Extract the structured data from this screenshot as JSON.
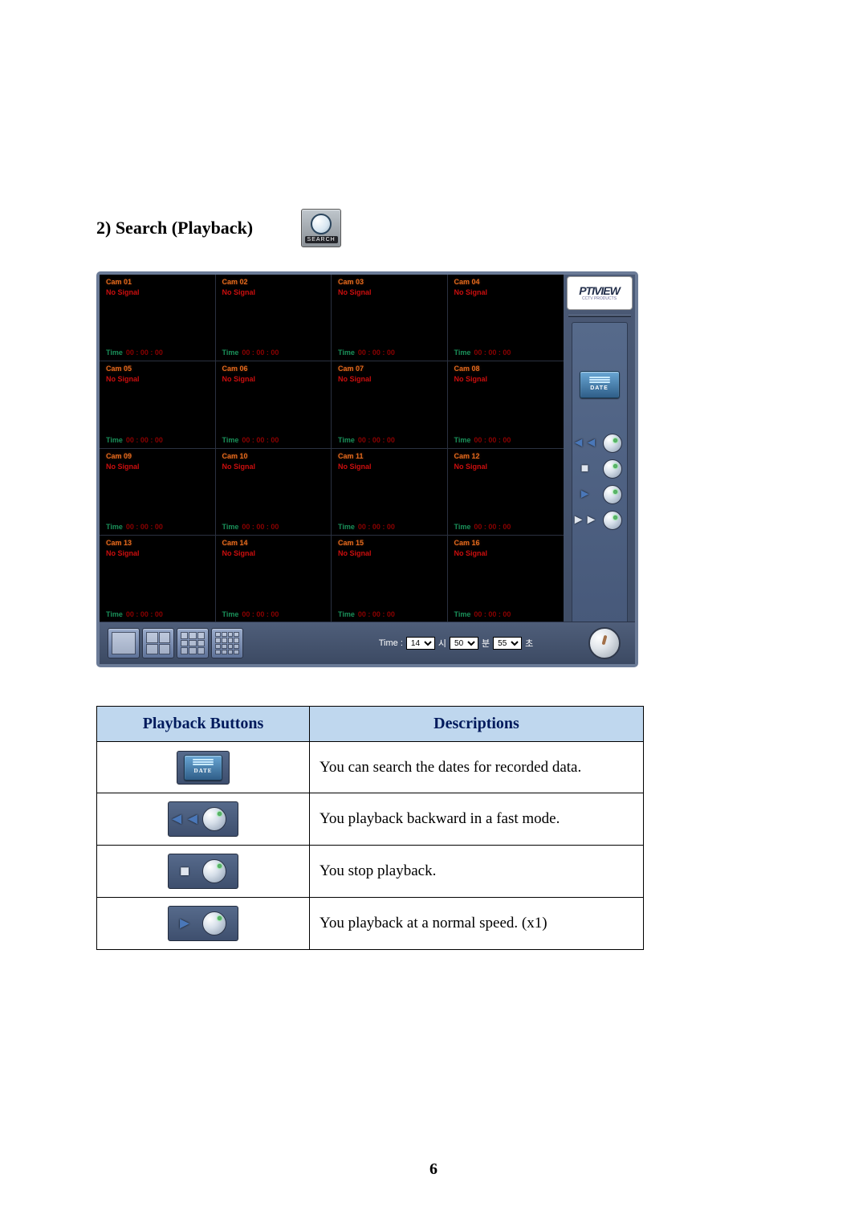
{
  "heading": "2) Search (Playback)",
  "search_tile_caption": "SEARCH",
  "brand": {
    "name": "PTIVIEW",
    "sub": "CCTV PRODUCTS"
  },
  "cam_status_default": "No Signal",
  "cam_time_label": "Time",
  "cam_time_value": "00 : 00 : 00",
  "cams": [
    "Cam 01",
    "Cam 02",
    "Cam 03",
    "Cam 04",
    "Cam 05",
    "Cam 06",
    "Cam 07",
    "Cam 08",
    "Cam 09",
    "Cam 10",
    "Cam 11",
    "Cam 12",
    "Cam 13",
    "Cam 14",
    "Cam 15",
    "Cam 16"
  ],
  "date_button_label": "DATE",
  "time_row": {
    "label": "Time :",
    "hour": "14",
    "hour_suffix": "시",
    "minute": "50",
    "minute_suffix": "분",
    "second": "55",
    "second_suffix": "초"
  },
  "table": {
    "head_left": "Playback Buttons",
    "head_right": "Descriptions",
    "rows": [
      "You can search the dates for recorded data.",
      "You playback backward in a fast mode.",
      "You stop playback.",
      "You playback at a normal speed. (x1)"
    ]
  },
  "page_number": "6"
}
